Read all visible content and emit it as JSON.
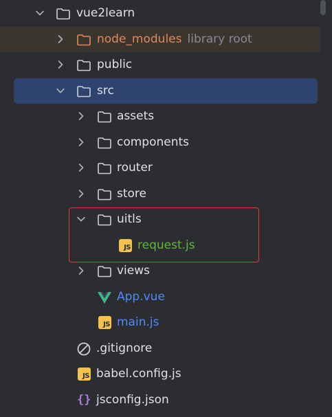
{
  "tree": {
    "root": {
      "label": "vue2learn"
    },
    "node_modules": {
      "label": "node_modules",
      "hint": "library root"
    },
    "public": {
      "label": "public"
    },
    "src": {
      "label": "src"
    },
    "assets": {
      "label": "assets"
    },
    "components": {
      "label": "components"
    },
    "router": {
      "label": "router"
    },
    "store": {
      "label": "store"
    },
    "uitls": {
      "label": "uitls"
    },
    "request_js": {
      "label": "request.js",
      "badge": "JS"
    },
    "views": {
      "label": "views"
    },
    "app_vue": {
      "label": "App.vue"
    },
    "main_js": {
      "label": "main.js",
      "badge": "JS"
    },
    "gitignore": {
      "label": ".gitignore"
    },
    "babel_config": {
      "label": "babel.config.js",
      "badge": "JS"
    },
    "jsconfig": {
      "label": "jsconfig.json",
      "glyph": "{}"
    }
  },
  "colors": {
    "background": "#2b2d30",
    "selected_row": "#2e436e",
    "excluded_row": "#3b3530",
    "default_text": "#dfe1e5",
    "excluded_text": "#e0895a",
    "hint_text": "#868a91",
    "modified_green": "#62b543",
    "added_blue": "#548af7",
    "js_badge": "#f2c14e",
    "vue_green": "#41b883",
    "highlight_border": "#d94141"
  }
}
